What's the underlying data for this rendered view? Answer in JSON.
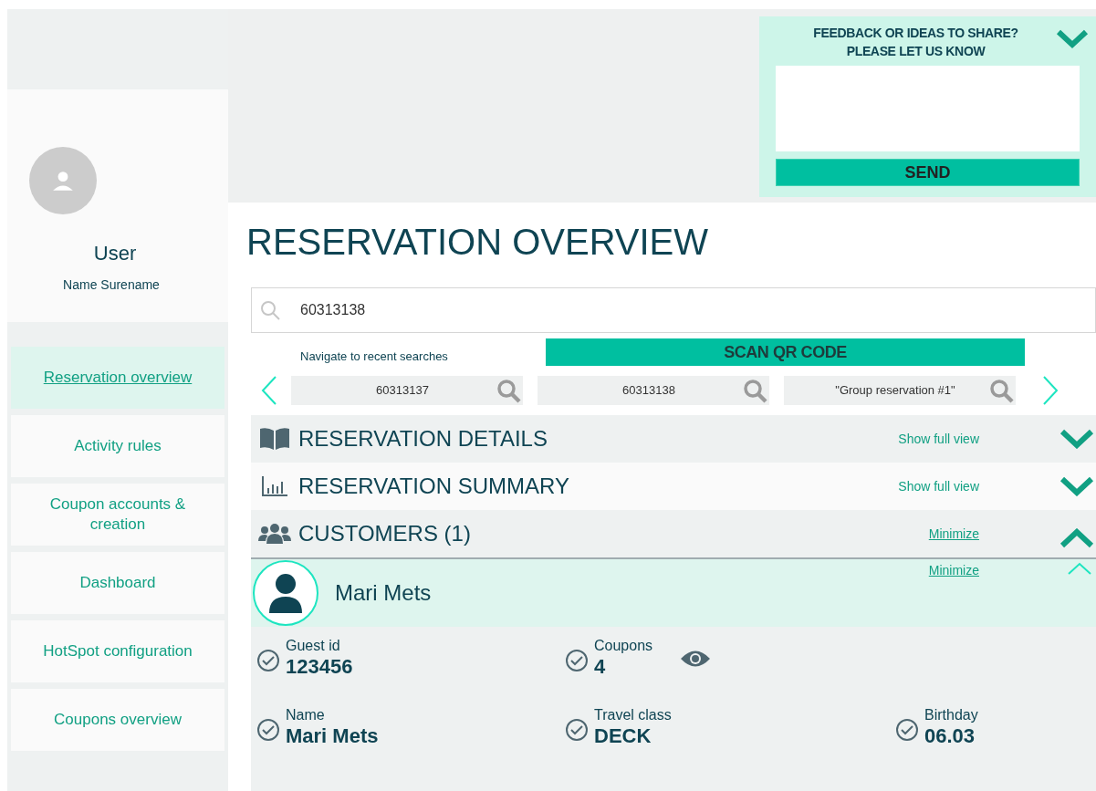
{
  "user": {
    "name": "User",
    "subtitle": "Name Surename"
  },
  "nav": [
    {
      "label": "Reservation overview",
      "selected": true
    },
    {
      "label": "Activity rules",
      "selected": false
    },
    {
      "label": "Coupon accounts & creation",
      "selected": false
    },
    {
      "label": "Dashboard",
      "selected": false
    },
    {
      "label": "HotSpot configuration",
      "selected": false
    },
    {
      "label": "Coupons overview",
      "selected": false
    }
  ],
  "feedback": {
    "title_lines": [
      "FEEDBACK OR IDEAS TO SHARE?",
      "PLEASE LET US KNOW"
    ],
    "send": "SEND"
  },
  "page_title": "RESERVATION OVERVIEW",
  "search": {
    "value": "60313138"
  },
  "recent": {
    "label": "Navigate to recent searches",
    "scan_button": "SCAN QR CODE",
    "items": [
      "60313137",
      "60313138",
      "\"Group reservation #1\""
    ]
  },
  "sections": [
    {
      "kind": "book",
      "title": "RESERVATION DETAILS",
      "action": "Show full view",
      "expanded": false
    },
    {
      "kind": "chart",
      "title": "RESERVATION SUMMARY",
      "action": "Show full view",
      "expanded": false
    },
    {
      "kind": "people",
      "title": "CUSTOMERS (1)",
      "action": "Minimize",
      "expanded": true
    }
  ],
  "customer": {
    "name": "Mari Mets",
    "action": "Minimize",
    "expanded": true,
    "rows": [
      [
        {
          "label": "Guest id",
          "value": "123456",
          "kind": "plain"
        },
        {
          "label": "Coupons",
          "value": "4",
          "kind": "viewable"
        }
      ],
      [
        {
          "label": "Name",
          "value": "Mari Mets",
          "kind": "plain"
        },
        {
          "label": "Travel class",
          "value": "DECK",
          "kind": "plain"
        },
        {
          "label": "Birthday",
          "value": "06.03",
          "kind": "plain"
        }
      ]
    ]
  }
}
